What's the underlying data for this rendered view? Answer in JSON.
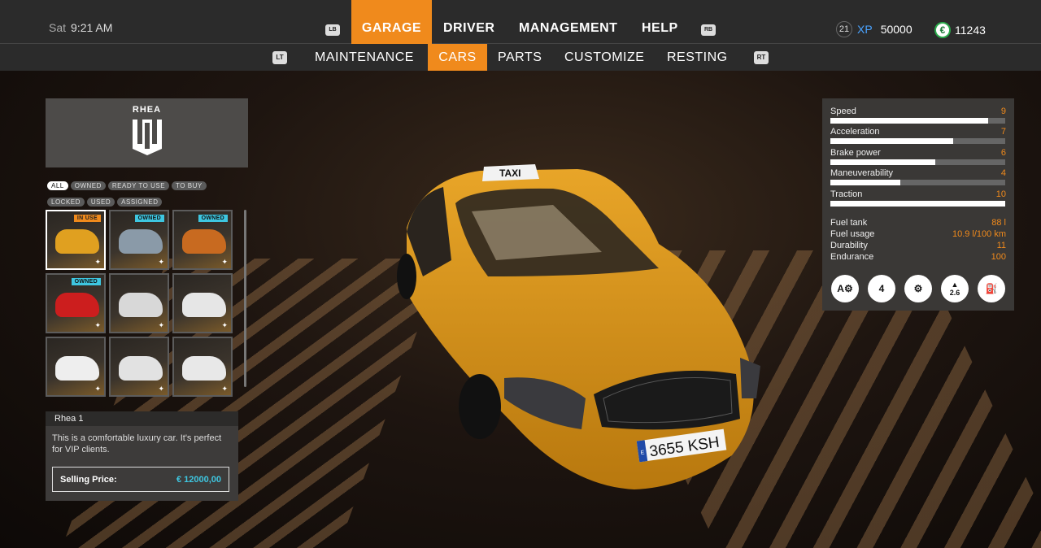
{
  "clock": {
    "day": "Sat",
    "time": "9:21 AM"
  },
  "top_nav": {
    "lb": "LB",
    "rb": "RB",
    "items": [
      "GARAGE",
      "DRIVER",
      "MANAGEMENT",
      "HELP"
    ],
    "active": "GARAGE"
  },
  "sub_nav": {
    "lt": "LT",
    "rt": "RT",
    "items": [
      "MAINTENANCE",
      "CARS",
      "PARTS",
      "CUSTOMIZE",
      "RESTING"
    ],
    "active": "CARS"
  },
  "player": {
    "level": "21",
    "xp_label": "XP",
    "xp": "50000",
    "currency_symbol": "€",
    "money": "11243"
  },
  "brand": {
    "name": "RHEA"
  },
  "filters": [
    "ALL",
    "OWNED",
    "READY TO USE",
    "TO BUY",
    "LOCKED",
    "USED",
    "ASSIGNED"
  ],
  "tiles": [
    {
      "tag": "IN USE",
      "color": "#e0a020"
    },
    {
      "tag": "OWNED",
      "color": "#8a9aa8"
    },
    {
      "tag": "OWNED",
      "color": "#c86a20"
    },
    {
      "tag": "OWNED",
      "color": "#cc1e1e"
    },
    {
      "tag": "",
      "color": "#d8d8d8"
    },
    {
      "tag": "",
      "color": "#e6e6e6"
    },
    {
      "tag": "",
      "color": "#eeeeee"
    },
    {
      "tag": "",
      "color": "#e2e2e2"
    },
    {
      "tag": "",
      "color": "#e8e8e8"
    }
  ],
  "info": {
    "title": "Rhea  1",
    "description": "This is a comfortable luxury car. It's perfect for VIP clients.",
    "price_label": "Selling Price:",
    "price_value": "€ 12000,00"
  },
  "stats": [
    {
      "name": "Speed",
      "value": "9",
      "fraction": 0.9
    },
    {
      "name": "Acceleration",
      "value": "7",
      "fraction": 0.7
    },
    {
      "name": "Brake power",
      "value": "6",
      "fraction": 0.6
    },
    {
      "name": "Maneuverability",
      "value": "4",
      "fraction": 0.4
    },
    {
      "name": "Traction",
      "value": "10",
      "fraction": 1.0
    }
  ],
  "specs": [
    {
      "name": "Fuel tank",
      "value": "88 l"
    },
    {
      "name": "Fuel usage",
      "value": "10.9 l/100 km"
    },
    {
      "name": "Durability",
      "value": "11"
    },
    {
      "name": "Endurance",
      "value": "100"
    }
  ],
  "feature_icons": [
    "automatic-gearbox-icon",
    "seats-4-icon",
    "engine-icon",
    "weight-icon",
    "fuel-pump-icon"
  ],
  "weight_label": "2.6",
  "taxi": {
    "roof_sign": "TAXI",
    "plate": "3655 KSH",
    "plate_country": "E"
  },
  "colors": {
    "accent": "#f08a1c",
    "owned": "#3ec6e0",
    "xp": "#4aa3ff",
    "money_green": "#2aa84a"
  }
}
